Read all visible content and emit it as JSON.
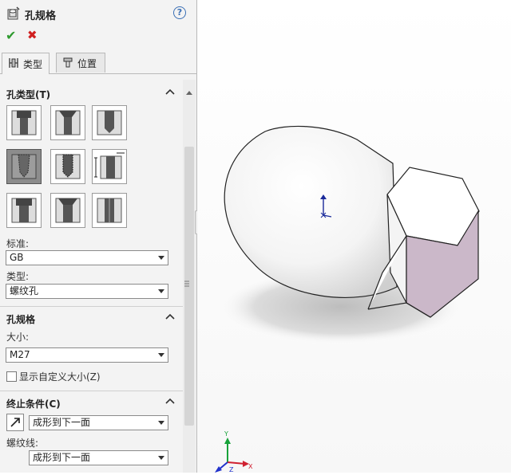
{
  "header": {
    "title": "孔规格",
    "help": "?"
  },
  "actions": {
    "ok": "✔",
    "cancel": "✖"
  },
  "tabs": [
    {
      "label": "类型"
    },
    {
      "label": "位置"
    }
  ],
  "hole_type": {
    "title": "孔类型(T)",
    "buttons": [
      "counterbore",
      "countersink",
      "simple-hole",
      "tapered-tap",
      "drilled-tap",
      "straight-tap",
      "counterbore-slot",
      "countersink-slot",
      "slot"
    ],
    "selected_index": 3,
    "standard_label": "标准:",
    "standard_value": "GB",
    "type_label": "类型:",
    "type_value": "螺纹孔"
  },
  "hole_spec": {
    "title": "孔规格",
    "size_label": "大小:",
    "size_value": "M27",
    "custom_size_label": "显示自定义大小(Z)",
    "custom_size_checked": false
  },
  "end_condition": {
    "title": "终止条件(C)",
    "value": "成形到下一面",
    "thread_label": "螺纹线:",
    "thread_value": "成形到下一面"
  },
  "viewport": {
    "axis_labels": {
      "x": "X",
      "y": "Y",
      "z": "Z"
    }
  },
  "colors": {
    "accent": "#3a6fb5",
    "ok": "#2f9a2f",
    "cancel": "#d02020",
    "hex_face": "#cbb8c9"
  }
}
